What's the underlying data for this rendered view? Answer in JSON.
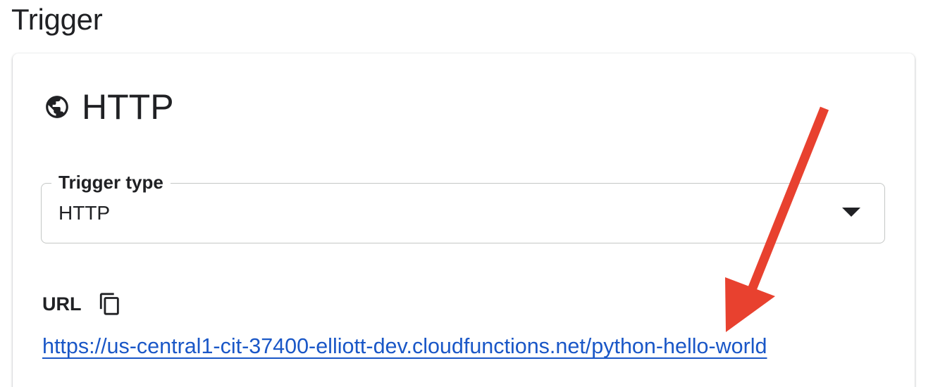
{
  "section": {
    "title": "Trigger"
  },
  "card": {
    "title": "HTTP",
    "header_icon": "globe-icon"
  },
  "trigger_type": {
    "label": "Trigger type",
    "value": "HTTP",
    "dropdown_icon": "arrow-drop-down-icon"
  },
  "url": {
    "label": "URL",
    "copy_icon": "copy-icon",
    "link": "https://us-central1-cit-37400-elliott-dev.cloudfunctions.net/python-hello-world"
  },
  "colors": {
    "link": "#1a57c7",
    "annotation_arrow": "#e8412f",
    "text": "#202124",
    "field_border": "#c4c7c5"
  }
}
